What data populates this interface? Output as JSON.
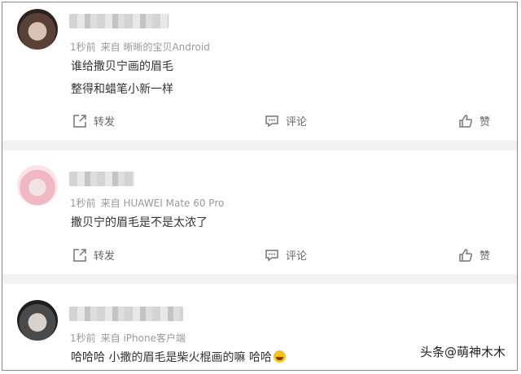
{
  "comments": [
    {
      "meta_time": "1秒前",
      "meta_source": "来自 晰晰的宝贝Android",
      "lines": [
        "谁给撒贝宁画的眉毛",
        "整得和蜡笔小新一样"
      ],
      "actions": {
        "repost": "转发",
        "comment": "评论",
        "like": "赞"
      }
    },
    {
      "meta_time": "1秒前",
      "meta_source": "来自 HUAWEI Mate 60 Pro",
      "lines": [
        "撒贝宁的眉毛是不是太浓了"
      ],
      "actions": {
        "repost": "转发",
        "comment": "评论",
        "like": "赞"
      }
    },
    {
      "meta_time": "1秒前",
      "meta_source": "来自 iPhone客户端",
      "lines": [
        "哈哈哈 小撒的眉毛是柴火棍画的嘛 哈哈"
      ]
    }
  ],
  "watermark": "头条@萌神木木",
  "icons": [
    "repost-icon",
    "comment-icon",
    "like-icon",
    "laughing-emoji-icon"
  ]
}
